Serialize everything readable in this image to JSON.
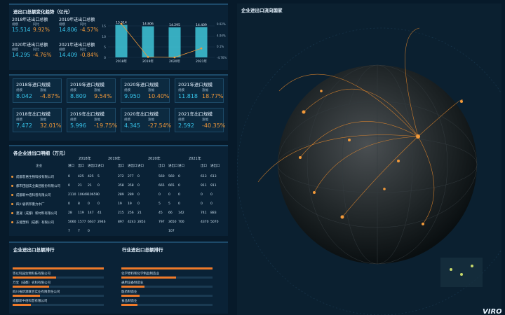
{
  "panels": {
    "top_title": "进出口总额变化趋势（亿元）",
    "table_title": "各企业进出口明细（万元）",
    "rank_left_title": "企业进出口总额排行",
    "rank_right_title": "行业进出口总额排行",
    "globe_title": "企业进出口流向国家",
    "watermark": "VIRON"
  },
  "summary_labels": {
    "amount": "规模",
    "yoy": "同比"
  },
  "total_cards": [
    {
      "title": "2018年进出口总额",
      "amount": "15.514",
      "yoy": "9.92%"
    },
    {
      "title": "2019年进出口总额",
      "amount": "14.806",
      "yoy": "-4.57%"
    },
    {
      "title": "2020年进出口总额",
      "amount": "14.295",
      "yoy": "-4.76%"
    },
    {
      "title": "2021年进出口总额",
      "amount": "14.409",
      "yoy": "-0.84%"
    }
  ],
  "detail_labels": {
    "amount": "规模",
    "yoy": "涨幅"
  },
  "detail_cards": [
    {
      "title": "2018年进口规模",
      "amount": "8.042",
      "yoy": "-4.87%"
    },
    {
      "title": "2019年进口规模",
      "amount": "8.809",
      "yoy": "9.54%"
    },
    {
      "title": "2020年进口规模",
      "amount": "9.950",
      "yoy": "10.40%"
    },
    {
      "title": "2021年进口规模",
      "amount": "11.818",
      "yoy": "18.77%"
    },
    {
      "title": "2018年出口规模",
      "amount": "7.472",
      "yoy": "32.01%"
    },
    {
      "title": "2019年出口规模",
      "amount": "5.996",
      "yoy": "-19.75%"
    },
    {
      "title": "2020年出口规模",
      "amount": "4.345",
      "yoy": "-27.54%"
    },
    {
      "title": "2021年出口规模",
      "amount": "2.592",
      "yoy": "-40.35%"
    }
  ],
  "chart_data": {
    "type": "bar",
    "categories": [
      "2018年",
      "2019年",
      "2020年",
      "2021年"
    ],
    "series": [
      {
        "values": [
          15.514,
          14.806,
          14.295,
          14.409
        ]
      },
      {
        "values": [
          9.92,
          -4.57,
          -4.76,
          -0.84
        ]
      }
    ],
    "bar_labels": [
      "15.514",
      "14.806",
      "14.295",
      "14.409"
    ],
    "left_ticks": [
      "15",
      "10",
      "5",
      "0"
    ],
    "right_ticks": [
      "9.92%",
      "4.94%",
      "0.1%",
      "-4.76%"
    ],
    "ylim": [
      0,
      16
    ],
    "y2lim": [
      -4.76,
      9.92
    ],
    "colors": {
      "bar": "#3fc6d8",
      "line": "#f19839"
    }
  },
  "table": {
    "company_header": "企业",
    "years": [
      "2018年",
      "2019年",
      "2020年",
      "2021年"
    ],
    "sub_headers": [
      "进口",
      "出口",
      "进出口"
    ],
    "rows": [
      {
        "name": "成都普惠生物科技有限公司",
        "v": [
          "0",
          "425",
          "425",
          "5",
          "272",
          "277",
          "0",
          "560",
          "560",
          "0",
          "613",
          "613"
        ]
      },
      {
        "name": "都市田园实业集团股份有限公司",
        "v": [
          "0",
          "21",
          "21",
          "0",
          "358",
          "358",
          "0",
          "665",
          "665",
          "0",
          "911",
          "911"
        ]
      },
      {
        "name": "成都新中倍科普有限公司",
        "v": [
          "2110",
          "10649",
          "10659",
          "0",
          "289",
          "289",
          "0",
          "0",
          "0",
          "0",
          "0",
          "0"
        ]
      },
      {
        "name": "四川省新邦重力水厂",
        "v": [
          "0",
          "8",
          "0",
          "0",
          "19",
          "19",
          "0",
          "5",
          "5",
          "0",
          "0",
          "0"
        ]
      },
      {
        "name": "夏凝（成都）新材料有限公司",
        "v": [
          "28",
          "119",
          "147",
          "41",
          "215",
          "256",
          "21",
          "45",
          "66",
          "142",
          "741",
          "883"
        ]
      },
      {
        "name": "东能塑料（成都）有限公司",
        "v": [
          "5060",
          "1577",
          "6637",
          "2946",
          "897",
          "4243",
          "2853",
          "797",
          "3650",
          "700",
          "4370",
          "5070"
        ]
      },
      {
        "name": "",
        "v": [
          "7",
          "7",
          "0",
          "",
          "",
          "",
          "",
          "",
          "107",
          "",
          "",
          ""
        ]
      }
    ]
  },
  "rank_left": [
    {
      "label": "",
      "value": 1.0
    },
    {
      "label": "等以科园生物科技有限公司",
      "value": 0.48
    },
    {
      "label": "万宝（成都）农科有限公司",
      "value": 0.4
    },
    {
      "label": "四川省新源联合实业有限责任公司",
      "value": 0.3
    },
    {
      "label": "成都新中倍科普有限公司",
      "value": 0.2
    }
  ],
  "rank_right": [
    {
      "label": "",
      "value": 1.0
    },
    {
      "label": "化学原料和化学制品制造业",
      "value": 0.6
    },
    {
      "label": "通用设备制造业",
      "value": 0.25
    },
    {
      "label": "医药制造业",
      "value": 0.2
    },
    {
      "label": "食品制造业",
      "value": 0.18
    }
  ]
}
